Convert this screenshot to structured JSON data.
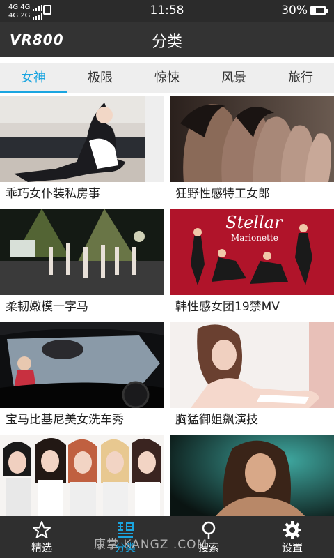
{
  "status_bar": {
    "network_top": "4G 4G",
    "network_bottom": "4G 2G",
    "time": "11:58",
    "battery": "30%",
    "battery_level": 0.3
  },
  "header": {
    "logo": "VR800",
    "title": "分类"
  },
  "tabs": [
    {
      "label": "女神",
      "active": true
    },
    {
      "label": "极限",
      "active": false
    },
    {
      "label": "惊悚",
      "active": false
    },
    {
      "label": "风景",
      "active": false
    },
    {
      "label": "旅行",
      "active": false
    }
  ],
  "videos": [
    {
      "title": "乖巧女仆装私房事",
      "image": "maid-costume-photo"
    },
    {
      "title": "狂野性感特工女郎",
      "image": "agent-women-profiles"
    },
    {
      "title": "柔韧嫩模一字马",
      "image": "stage-performance"
    },
    {
      "title": "韩性感女团19禁MV",
      "image": "stellar-marionette-poster"
    },
    {
      "title": "宝马比基尼美女洗车秀",
      "image": "car-wash-interior"
    },
    {
      "title": "胸猛御姐飙演技",
      "image": "woman-portrait"
    },
    {
      "title": "",
      "image": "girl-group-lineup"
    },
    {
      "title": "",
      "image": "green-light-portrait"
    }
  ],
  "poster_text": {
    "line1": "Stellar",
    "line2": "Marionette"
  },
  "bottom_nav": [
    {
      "label": "精选",
      "icon": "star-icon",
      "active": false
    },
    {
      "label": "分类",
      "icon": "category-icon",
      "active": true
    },
    {
      "label": "搜索",
      "icon": "search-icon",
      "active": false
    },
    {
      "label": "设置",
      "icon": "gear-icon",
      "active": false
    }
  ],
  "watermark": "康掌 KANGZ .COM",
  "colors": {
    "accent": "#1aa5e0",
    "header_bg": "#333333",
    "tab_bg": "#eeeeee",
    "nav_bg": "#2f2f2f"
  }
}
